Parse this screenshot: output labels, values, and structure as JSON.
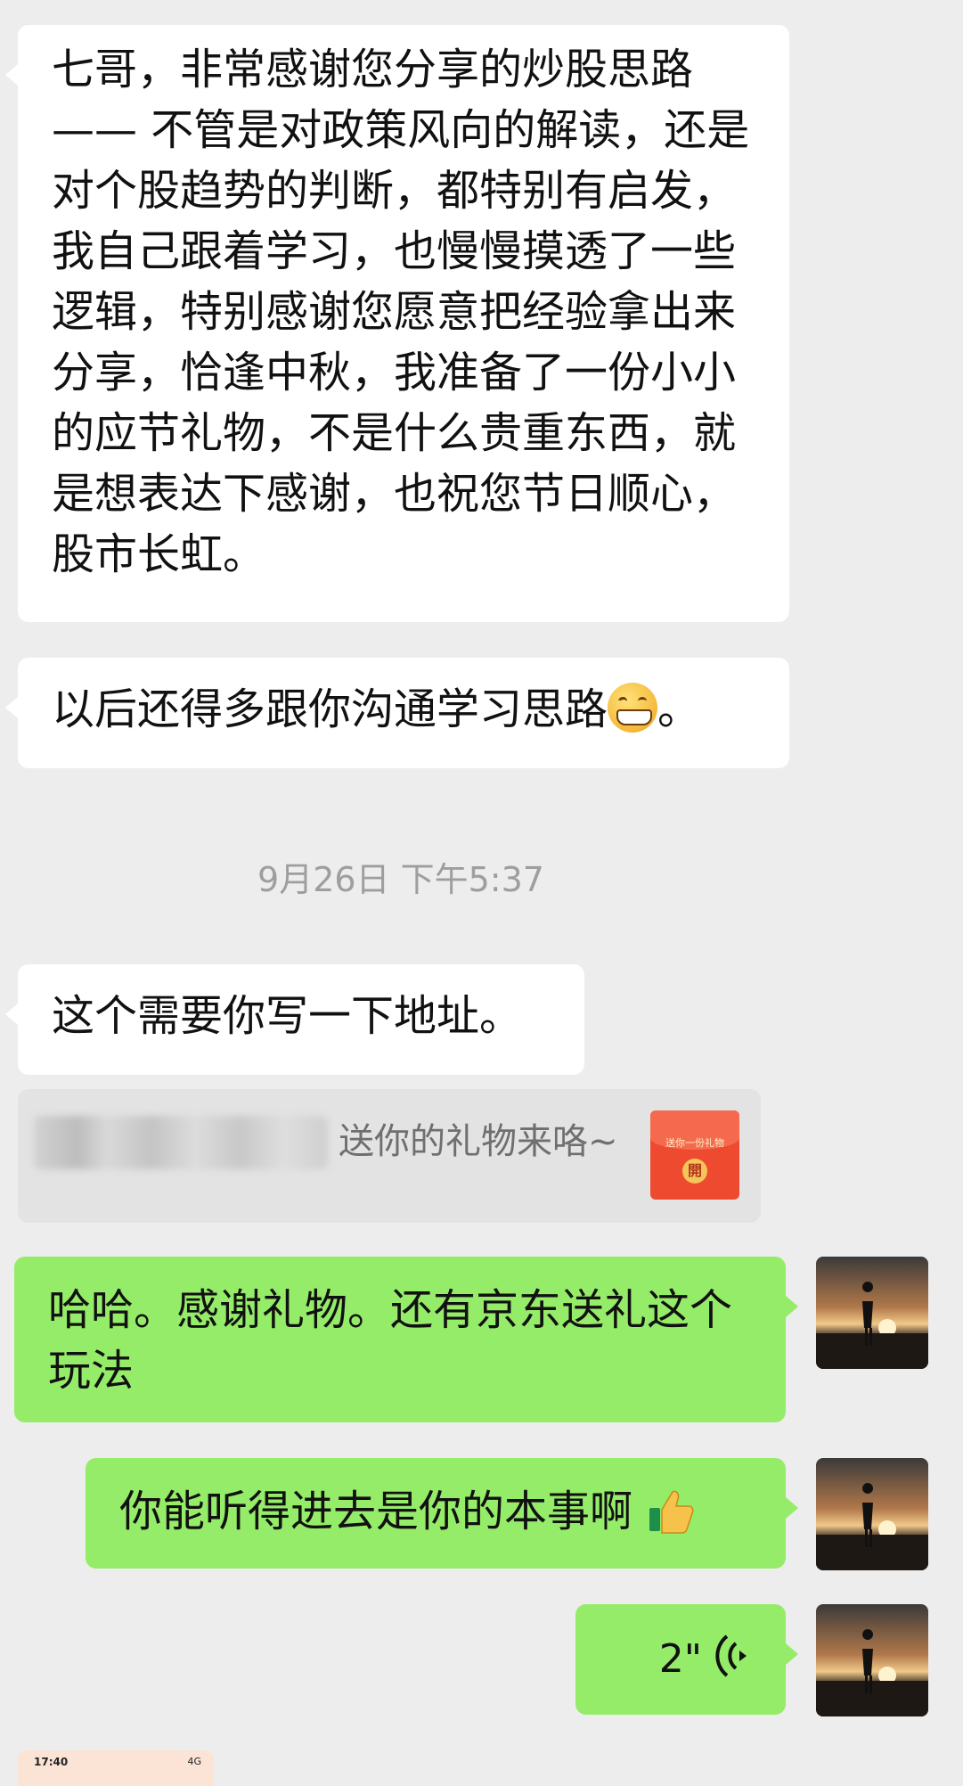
{
  "messages": {
    "incoming_1": "七哥，非常感谢您分享的炒股思路 —— 不管是对政策风向的解读，还是对个股趋势的判断，都特别有启发，我自己跟着学习，也慢慢摸透了一些逻辑，特别感谢您愿意把经验拿出来分享，恰逢中秋，我准备了一份小小的应节礼物，不是什么贵重东西，就是想表达下感谢，也祝您节日顺心，股市长虹。",
    "incoming_2_text": "以后还得多跟你沟通学习思路",
    "incoming_2_end": "。",
    "incoming_2_emoji": "grinning-face-icon",
    "timestamp": "9月26日 下午5:37",
    "incoming_3": "这个需要你写一下地址。",
    "gift_text": "送你的礼物来咯~",
    "gift_envelope_label": "送你一份礼物",
    "gift_envelope_seal": "開",
    "outgoing_1": "哈哈。感谢礼物。还有京东送礼这个玩法",
    "outgoing_2_text": "你能听得进去是你的本事啊",
    "outgoing_2_emoji": "thumbs-up-icon",
    "voice_duration": "2\""
  },
  "preview": {
    "time": "17:40",
    "signal": "4G"
  }
}
